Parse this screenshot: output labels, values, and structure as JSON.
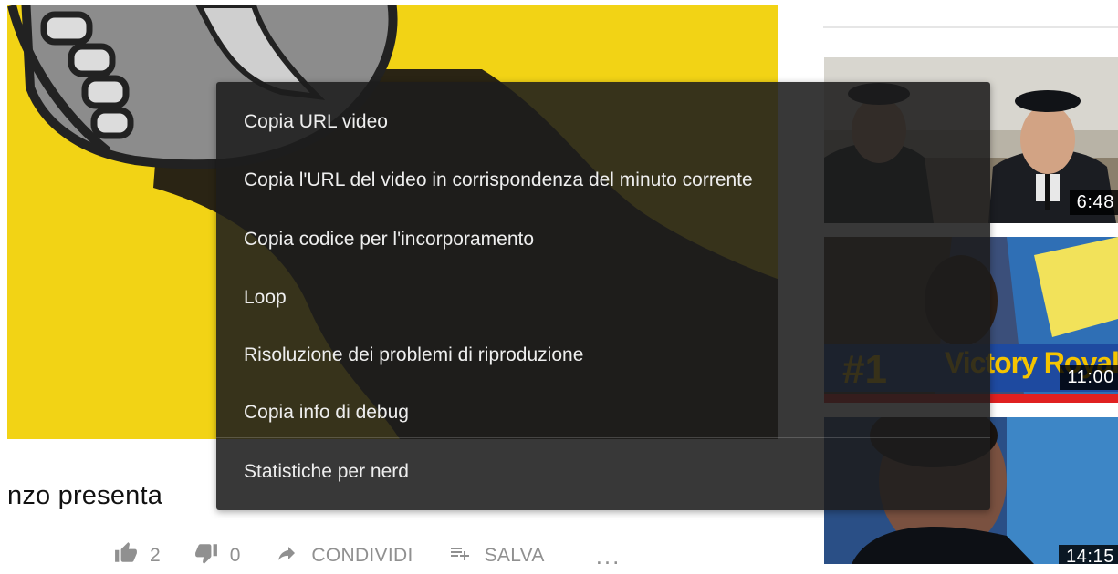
{
  "video": {
    "title": "nzo presenta",
    "likes": "2",
    "dislikes": "0",
    "share_label": "CONDIVIDI",
    "save_label": "SALVA",
    "more_label": "..."
  },
  "context_menu": {
    "items": [
      "Copia URL video",
      "Copia l'URL del video in corrispondenza del minuto corrente",
      "Copia codice per l'incorporamento",
      "Loop",
      "Risoluzione dei problemi di riproduzione",
      "Copia info di debug",
      "Statistiche per nerd"
    ]
  },
  "sidebar": {
    "videos": [
      {
        "duration": "6:48",
        "overlay_text": ""
      },
      {
        "duration": "11:00",
        "overlay_text": "Victory Royale!"
      },
      {
        "duration": "14:15",
        "overlay_text": ""
      }
    ]
  },
  "colors": {
    "player_yellow": "#f2d315",
    "menu_bg": "#1c1c1c",
    "menu_text": "#eeeeee",
    "action_gray": "#909090"
  },
  "icons": [
    "like-icon",
    "dislike-icon",
    "share-icon",
    "save-playlist-icon",
    "more-icon"
  ]
}
